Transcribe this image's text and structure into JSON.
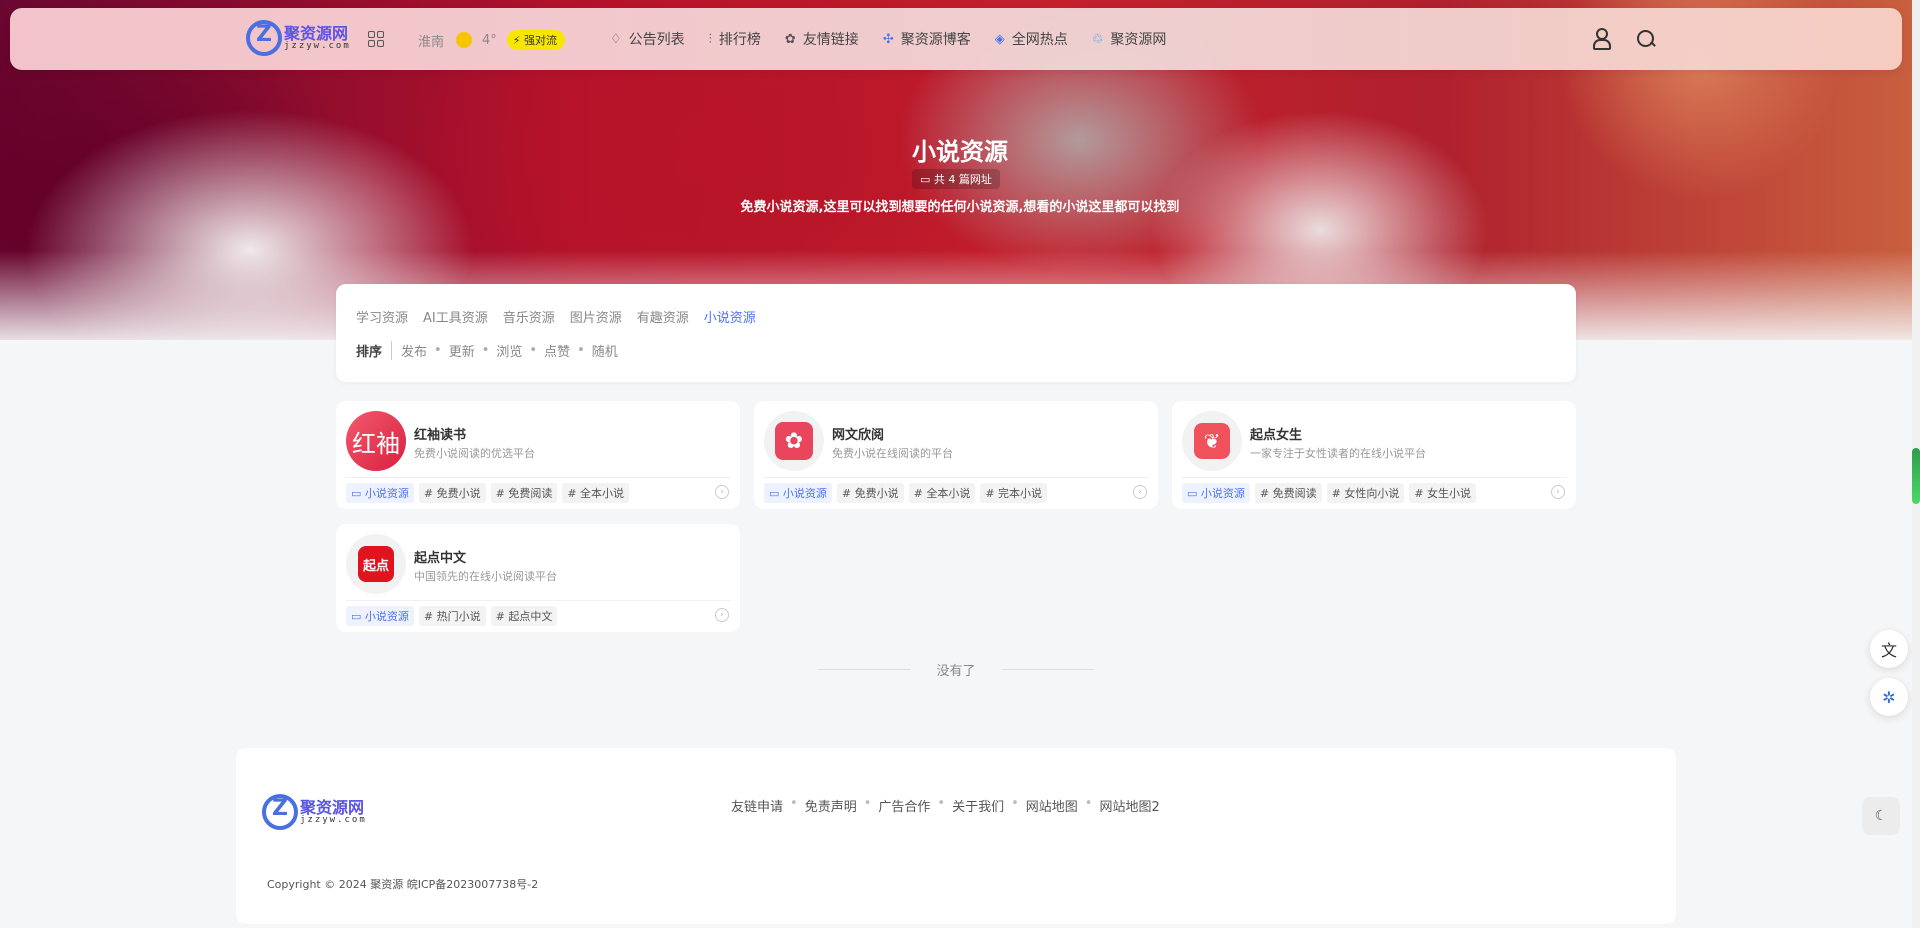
{
  "header": {
    "logo_text": "聚资源网",
    "logo_sub": "jzzyw.com",
    "weather_city": "淮南",
    "weather_temp": "4°",
    "weather_badge": "强对流",
    "nav": [
      {
        "label": "公告列表",
        "icon": "bell-icon"
      },
      {
        "label": "排行榜",
        "icon": "ranking-icon"
      },
      {
        "label": "友情链接",
        "icon": "link-icon"
      },
      {
        "label": "聚资源博客",
        "icon": "blog-icon"
      },
      {
        "label": "全网热点",
        "icon": "layers-icon"
      },
      {
        "label": "聚资源网",
        "icon": "recycle-icon"
      }
    ]
  },
  "hero": {
    "title": "小说资源",
    "count_label": "共 4 篇网址",
    "description": "免费小说资源,这里可以找到想要的任何小说资源,想看的小说这里都可以找到"
  },
  "filter": {
    "categories": [
      "学习资源",
      "AI工具资源",
      "音乐资源",
      "图片资源",
      "有趣资源",
      "小说资源"
    ],
    "active_category": "小说资源",
    "sort_label": "排序",
    "sort_options": [
      "发布",
      "更新",
      "浏览",
      "点赞",
      "随机"
    ]
  },
  "cards": [
    {
      "name": "红袖读书",
      "desc": "免费小说阅读的优选平台",
      "category": "小说资源",
      "tags": [
        "# 免费小说",
        "# 免费阅读",
        "# 全本小说"
      ],
      "icon_text": "红袖",
      "icon_color": "#e8384f"
    },
    {
      "name": "网文欣阅",
      "desc": "免费小说在线阅读的平台",
      "category": "小说资源",
      "tags": [
        "# 免费小说",
        "# 全本小说",
        "# 完本小说"
      ],
      "icon_text": "",
      "icon_color": "#e9455c"
    },
    {
      "name": "起点女生",
      "desc": "一家专注于女性读者的在线小说平台",
      "category": "小说资源",
      "tags": [
        "# 免费阅读",
        "# 女性向小说",
        "# 女生小说"
      ],
      "icon_text": "",
      "icon_color": "#f0525c"
    },
    {
      "name": "起点中文",
      "desc": "中国领先的在线小说阅读平台",
      "category": "小说资源",
      "tags": [
        "# 热门小说",
        "# 起点中文"
      ],
      "icon_text": "起点",
      "icon_color": "#e0141e"
    }
  ],
  "no_more": "没有了",
  "footer": {
    "links": [
      "友链申请",
      "免责声明",
      "广告合作",
      "关于我们",
      "网站地图",
      "网站地图2"
    ],
    "copyright": "Copyright © 2024 聚资源 皖ICP备2023007738号-2"
  },
  "colors": {
    "accent": "#4a73f0",
    "hero_red": "#b3122b",
    "badge_yellow": "#f7e600"
  }
}
